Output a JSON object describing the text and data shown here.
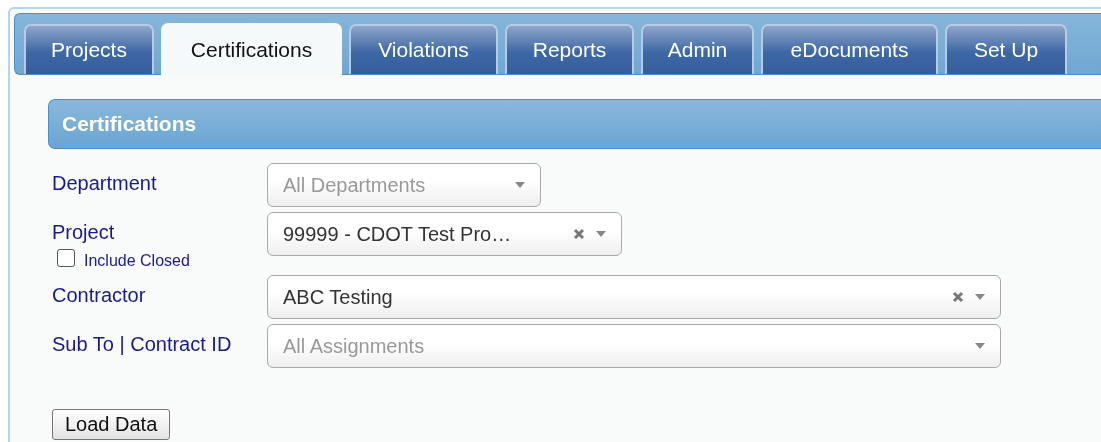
{
  "tabs": [
    {
      "label": "Projects",
      "selected": false
    },
    {
      "label": "Certifications",
      "selected": true
    },
    {
      "label": "Violations",
      "selected": false
    },
    {
      "label": "Reports",
      "selected": false
    },
    {
      "label": "Admin",
      "selected": false
    },
    {
      "label": "eDocuments",
      "selected": false
    },
    {
      "label": "Set Up",
      "selected": false
    }
  ],
  "panel": {
    "title": "Certifications"
  },
  "fields": [
    {
      "label": "Department",
      "placeholder": "All Departments",
      "clearable": false
    },
    {
      "label": "Project",
      "value": "99999 - CDOT Test Pro…",
      "clearable": true,
      "checkbox": {
        "label": "Include Closed",
        "checked": false
      }
    },
    {
      "label": "Contractor",
      "value": "ABC Testing",
      "clearable": true
    },
    {
      "label": "Sub To | Contract ID",
      "placeholder": "All Assignments",
      "clearable": false
    }
  ],
  "load_button": "Load Data"
}
